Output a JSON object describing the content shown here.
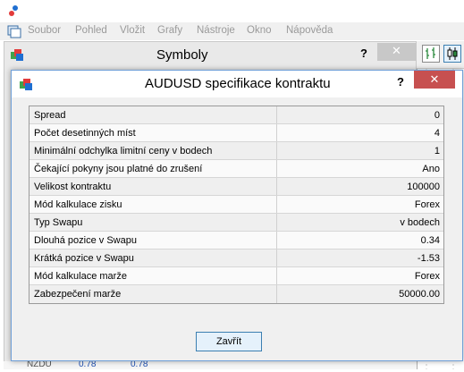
{
  "menubar": {
    "items": [
      "Soubor",
      "Pohled",
      "Vložit",
      "Grafy",
      "Nástroje",
      "Okno",
      "Nápověda"
    ]
  },
  "symbols_window": {
    "title": "Symboly",
    "help_label": "?",
    "close_label": "✕"
  },
  "dialog": {
    "title": "AUDUSD specifikace kontraktu",
    "help_label": "?",
    "close_label": "✕",
    "rows": [
      {
        "label": "Spread",
        "value": "0"
      },
      {
        "label": "Počet desetinných míst",
        "value": "4"
      },
      {
        "label": "Minimální odchylka limitní ceny v bodech",
        "value": "1"
      },
      {
        "label": "Čekající pokyny jsou platné do zrušení",
        "value": "Ano"
      },
      {
        "label": "Velikost kontraktu",
        "value": "100000"
      },
      {
        "label": "Mód kalkulace zisku",
        "value": "Forex"
      },
      {
        "label": "Typ Swapu",
        "value": "v bodech"
      },
      {
        "label": "Dlouhá pozice v Swapu",
        "value": "0.34"
      },
      {
        "label": "Krátká pozice v Swapu",
        "value": "-1.53"
      },
      {
        "label": "Mód kalkulace marže",
        "value": "Forex"
      },
      {
        "label": "Zabezpečení marže",
        "value": "50000.00"
      }
    ],
    "close_button": "Zavřít"
  },
  "bottom_strip": {
    "symbol": "NZDU",
    "bid": "0.78",
    "ask": "0.78"
  },
  "colors": {
    "dialog_border": "#6f9fd8",
    "close_red": "#c75050",
    "button_border": "#3c7fb1",
    "button_fill": "#e5f1fb"
  }
}
